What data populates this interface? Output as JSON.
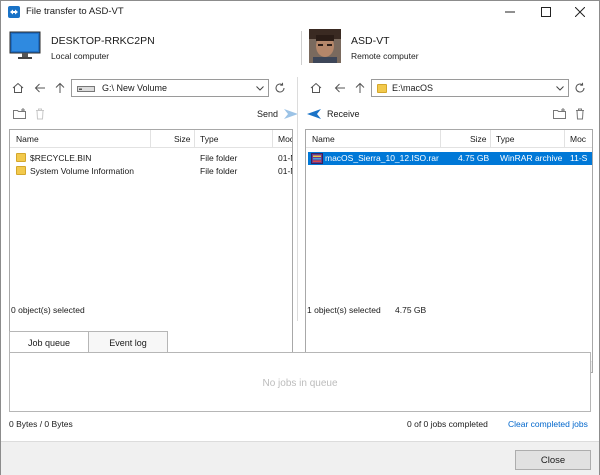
{
  "window": {
    "title": "File transfer to ASD-VT"
  },
  "local": {
    "name": "DESKTOP-RRKC2PN",
    "subtitle": "Local computer",
    "path": "G:\\  New Volume",
    "action_label": "Send",
    "columns": [
      "Name",
      "Size",
      "Type",
      "Moc"
    ],
    "rows": [
      {
        "name": "$RECYCLE.BIN",
        "size": "",
        "type": "File folder",
        "modified": "01-N"
      },
      {
        "name": "System Volume Information",
        "size": "",
        "type": "File folder",
        "modified": "01-N"
      }
    ],
    "status": "0 object(s) selected"
  },
  "remote": {
    "name": "ASD-VT",
    "subtitle": "Remote computer",
    "path": "E:\\macOS",
    "action_label": "Receive",
    "columns": [
      "Name",
      "Size",
      "Type",
      "Moc"
    ],
    "rows": [
      {
        "name": "macOS_Sierra_10_12.ISO.rar",
        "size": "4.75 GB",
        "type": "WinRAR archive",
        "modified": "11-S"
      }
    ],
    "status": "1 object(s) selected",
    "status_size": "4.75 GB"
  },
  "tabs": [
    "Job queue",
    "Event log"
  ],
  "queue": {
    "empty_text": "No jobs in queue"
  },
  "footer": {
    "bytes": "0 Bytes / 0 Bytes",
    "jobs": "0 of 0 jobs completed",
    "clear_link": "Clear completed jobs"
  },
  "close_label": "Close",
  "colors": {
    "accent": "#0078d7",
    "send_arrow": "#9cc3e6",
    "receive_arrow": "#1a73c7"
  }
}
